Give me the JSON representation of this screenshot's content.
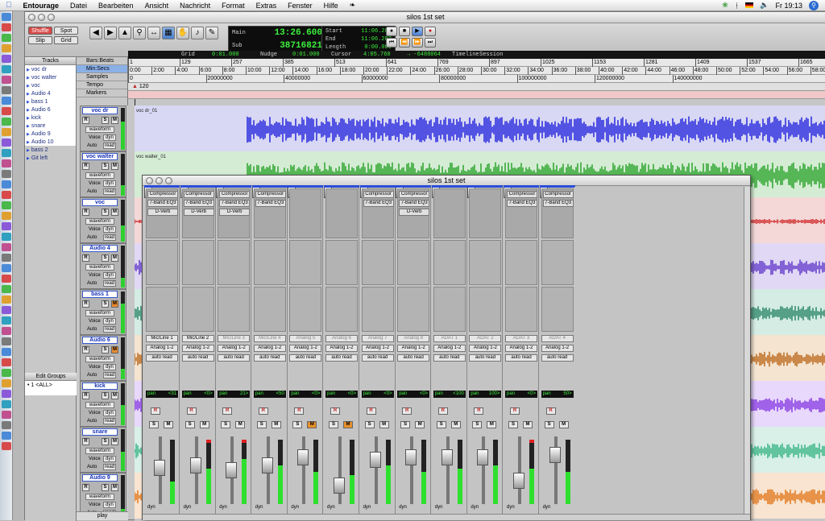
{
  "menubar": {
    "apple_icon": "apple-icon",
    "app": "Entourage",
    "items": [
      "Datei",
      "Bearbeiten",
      "Ansicht",
      "Nachricht",
      "Format",
      "Extras",
      "Fenster",
      "Hilfe"
    ],
    "clock": "Fr 19:13"
  },
  "window": {
    "title": "silos 1st set"
  },
  "toolbar": {
    "modes": [
      "Shuffle",
      "Spot",
      "Slip",
      "Grid"
    ],
    "counter": {
      "main_label": "Main",
      "main_value": "13:26.600",
      "sub_label": "Sub",
      "sub_value": "38716821"
    },
    "selection": {
      "start_label": "Start",
      "start": "11:06.282",
      "end_label": "End",
      "end": "11:06.282",
      "length_label": "Length",
      "length": "0:00.000"
    }
  },
  "strip": {
    "grid_label": "Grid",
    "grid_value": "0:01.000",
    "nudge_label": "Nudge",
    "nudge_value": "0:01.000",
    "cursor_label": "Cursor",
    "cursor_value": "4:05.760",
    "cursor_extra": "→ -6488064",
    "timeline_label": "Timeline",
    "session_label": "Session"
  },
  "tracks_list": {
    "header": "Tracks",
    "items": [
      "voc dr",
      "voc walter",
      "voc",
      "Audio 4",
      "bass 1",
      "Audio 6",
      "kick",
      "snare",
      "Audio 9",
      "Audio 10",
      "bass 2",
      "Git left"
    ],
    "edit_groups_header": "Edit Groups",
    "edit_groups_item": "• 1 <ALL>"
  },
  "ruler_labels": [
    "Bars:Beats",
    "Min:Secs",
    "Samples",
    "Tempo",
    "Markers"
  ],
  "rulers": {
    "bars": [
      "1",
      "129",
      "257",
      "385",
      "513",
      "641",
      "769",
      "897",
      "1025",
      "1153",
      "1281",
      "1409",
      "1537",
      "1665",
      "1793"
    ],
    "minsecs": [
      "0:00",
      "2:00",
      "4:00",
      "6:00",
      "8:00",
      "10:00",
      "12:00",
      "14:00",
      "16:00",
      "18:00",
      "20:00",
      "22:00",
      "24:00",
      "26:00",
      "28:00",
      "30:00",
      "32:00",
      "34:00",
      "36:00",
      "38:00",
      "40:00",
      "42:00",
      "44:00",
      "46:00",
      "48:00",
      "50:00",
      "52:00",
      "54:00",
      "56:00",
      "58:00"
    ],
    "samples": [
      "0",
      "20000000",
      "40000000",
      "60000000",
      "80000000",
      "100000000",
      "120000000",
      "140000000"
    ],
    "tempo": "120"
  },
  "tracks": [
    {
      "name": "voc dr",
      "mute": false,
      "color": "#1a1adc",
      "bg": "#d8d8f4",
      "clip": "voc dr_01"
    },
    {
      "name": "voc walter",
      "mute": false,
      "color": "#20a020",
      "bg": "#d4ecd4",
      "clip": "voc walter_01"
    },
    {
      "name": "voc",
      "mute": false,
      "color": "#d02020",
      "bg": "#f4d8d8",
      "clip": ""
    },
    {
      "name": "Audio 4",
      "mute": false,
      "color": "#5a30c8",
      "bg": "#e0d8f4",
      "clip": ""
    },
    {
      "name": "bass 1",
      "mute": true,
      "color": "#208060",
      "bg": "#d4ece4",
      "clip": ""
    },
    {
      "name": "Audio 6",
      "mute": true,
      "color": "#b86010",
      "bg": "#f4e4d0",
      "clip": ""
    },
    {
      "name": "kick",
      "mute": false,
      "color": "#8030e0",
      "bg": "#e8d8fc",
      "clip": ""
    },
    {
      "name": "snare",
      "mute": false,
      "color": "#30b080",
      "bg": "#d8f0e8",
      "clip": ""
    },
    {
      "name": "Audio 9",
      "mute": false,
      "color": "#e07010",
      "bg": "#f8e4d0",
      "clip": ""
    }
  ],
  "track_controls": {
    "rec": "R",
    "solo": "S",
    "mute": "M",
    "view": "waveform",
    "voice": "Voice",
    "dyn": "dyn",
    "auto": "Auto",
    "read": "read"
  },
  "play_label": "play",
  "mixer": {
    "title": "silos 1st set",
    "channels": [
      {
        "inserts": [
          "Compressor",
          "7-Band EQ3",
          "D-Verb"
        ],
        "input": "Mic/Line 1",
        "input_dim": false,
        "output": "Analog 1-2",
        "auto": "auto read",
        "pan": "<31",
        "mute": false,
        "fader": 0.55,
        "meter": 0.35
      },
      {
        "inserts": [
          "Compressor",
          "7-Band EQ3",
          "D-Verb"
        ],
        "input": "Mic/Line 2",
        "input_dim": false,
        "output": "Analog 1-2",
        "auto": "auto read",
        "pan": "<0>",
        "mute": false,
        "fader": 0.6,
        "meter": 0.55
      },
      {
        "inserts": [
          "Compressor",
          "7-Band EQ3",
          "D-Verb"
        ],
        "input": "Mic/Line 3",
        "input_dim": true,
        "output": "Analog 1-2",
        "auto": "auto read",
        "pan": "21>",
        "mute": false,
        "fader": 0.5,
        "meter": 0.7
      },
      {
        "inserts": [
          "Compressor",
          "7-Band EQ3"
        ],
        "input": "Mic/Line 4",
        "input_dim": true,
        "output": "Analog 1-2",
        "auto": "auto read",
        "pan": "<50",
        "mute": false,
        "fader": 0.6,
        "meter": 0.6
      },
      {
        "inserts": [],
        "input": "Analog 5",
        "input_dim": true,
        "output": "Analog 1-2",
        "auto": "auto read",
        "pan": "<0>",
        "mute": true,
        "fader": 0.75,
        "meter": 0.5
      },
      {
        "inserts": [],
        "input": "Analog 6",
        "input_dim": true,
        "output": "Analog 1-2",
        "auto": "auto read",
        "pan": "<0>",
        "mute": true,
        "fader": 0.2,
        "meter": 0.45
      },
      {
        "inserts": [
          "Compressor",
          "7-Band EQ3"
        ],
        "input": "Analog 7",
        "input_dim": true,
        "output": "Analog 1-2",
        "auto": "auto read",
        "pan": "<0>",
        "mute": false,
        "fader": 0.7,
        "meter": 0.6
      },
      {
        "inserts": [
          "Compressor",
          "7-Band EQ3",
          "D-Verb"
        ],
        "input": "Analog 8",
        "input_dim": true,
        "output": "Analog 1-2",
        "auto": "auto read",
        "pan": "<0>",
        "mute": false,
        "fader": 0.75,
        "meter": 0.5
      },
      {
        "inserts": [],
        "input": "ADAT 1",
        "input_dim": true,
        "output": "Analog 1-2",
        "auto": "auto read",
        "pan": "<100",
        "mute": false,
        "fader": 0.75,
        "meter": 0.55
      },
      {
        "inserts": [],
        "input": "ADAT 2",
        "input_dim": true,
        "output": "Analog 1-2",
        "auto": "auto read",
        "pan": "100>",
        "mute": false,
        "fader": 0.75,
        "meter": 0.6
      },
      {
        "inserts": [
          "Compressor",
          "7-Band EQ3"
        ],
        "input": "ADAT 3",
        "input_dim": true,
        "output": "Analog 1-2",
        "auto": "auto read",
        "pan": "<0>",
        "mute": false,
        "fader": 0.3,
        "meter": 0.55
      },
      {
        "inserts": [
          "Compressor",
          "7-Band EQ3"
        ],
        "input": "ADAT 4",
        "input_dim": true,
        "output": "Analog 1-2",
        "auto": "auto read",
        "pan": "50>",
        "mute": false,
        "fader": 0.8,
        "meter": 0.5
      }
    ],
    "pan_label": "pan",
    "rec": "R",
    "solo": "S",
    "mute": "M",
    "dyn": "dyn"
  },
  "playhead_time": "12:20"
}
